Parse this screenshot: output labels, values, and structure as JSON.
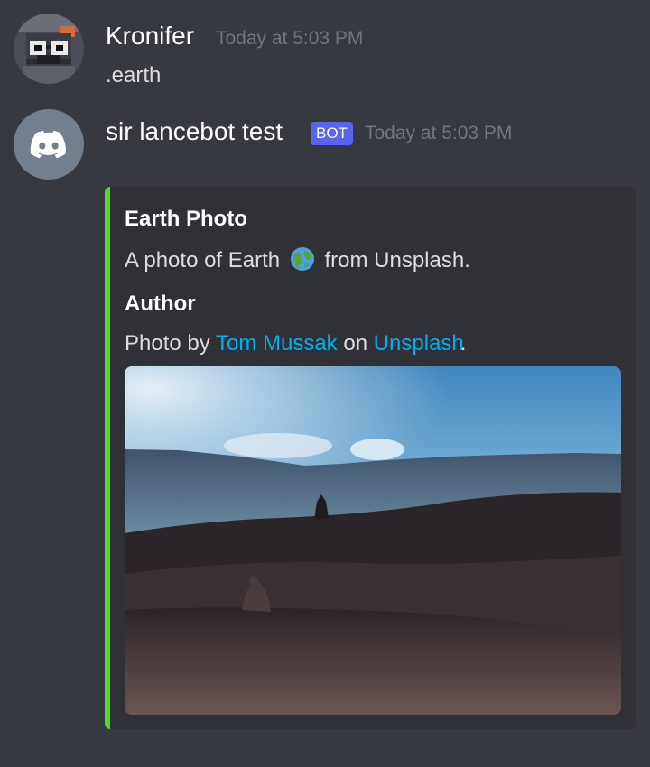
{
  "messages": [
    {
      "username": "Kronifer",
      "timestamp": "Today at 5:03 PM",
      "content": ".earth"
    },
    {
      "username": "sir lancebot test",
      "bot_tag": "BOT",
      "timestamp": "Today at 5:03 PM"
    }
  ],
  "embed": {
    "accent_color": "#5ad62c",
    "title": "Earth Photo",
    "description_prefix": "A photo of Earth",
    "description_emoji": "earth-americas-emoji",
    "description_suffix": "from Unsplash.",
    "field": {
      "name": "Author",
      "value_prefix": "Photo by",
      "author_link": "Tom Mussak",
      "value_middle": "on",
      "source_link": "Unsplash",
      "value_suffix": "."
    }
  },
  "colors": {
    "background": "#36393f",
    "embed_background": "#2f3136",
    "link": "#00aff4",
    "bot_tag": "#5865f2"
  }
}
